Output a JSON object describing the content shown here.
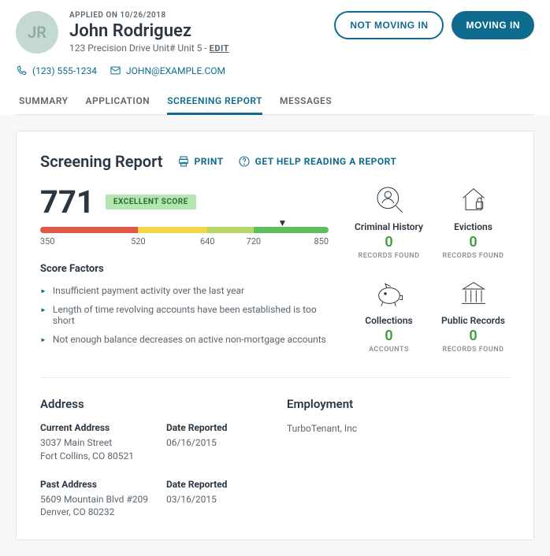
{
  "header": {
    "initials": "JR",
    "applied_label": "APPLIED ON 10/26/2018",
    "name": "John Rodriguez",
    "address": "123 Precision Drive Unit# Unit 5 - ",
    "edit": "EDIT",
    "phone": "(123) 555-1234",
    "email": "JOHN@EXAMPLE.COM",
    "btn_not_moving": "NOT MOVING IN",
    "btn_moving": "MOVING IN"
  },
  "tabs": {
    "summary": "SUMMARY",
    "application": "APPLICATION",
    "screening": "SCREENING REPORT",
    "messages": "MESSAGES"
  },
  "report": {
    "title": "Screening Report",
    "print": "PRINT",
    "help": "GET HELP READING A REPORT",
    "score": "771",
    "badge": "EXCELLENT SCORE",
    "ticks": {
      "t0": "350",
      "t1": "520",
      "t2": "640",
      "t3": "720",
      "t4": "850"
    },
    "factors_title": "Score Factors",
    "factors": {
      "f0": "Insufficient payment activity over the last year",
      "f1": "Length of time revolving accounts have been established is too short",
      "f2": "Not enough balance decreases on active non-mortgage accounts"
    }
  },
  "records": {
    "criminal": {
      "label": "Criminal History",
      "count": "0",
      "sub": "RECORDS FOUND"
    },
    "evictions": {
      "label": "Evictions",
      "count": "0",
      "sub": "RECORDS FOUND"
    },
    "collections": {
      "label": "Collections",
      "count": "0",
      "sub": "ACCOUNTS"
    },
    "public": {
      "label": "Public Records",
      "count": "0",
      "sub": "RECORDS FOUND"
    }
  },
  "bottom": {
    "address_title": "Address",
    "current_label": "Current Address",
    "current_line1": "3037 Main Street",
    "current_line2": "Fort Collins, CO 80521",
    "date_label": "Date Reported",
    "current_date": "06/16/2015",
    "past_label": "Past Address",
    "past_line1": "5609 Mountain Blvd #209",
    "past_line2": "Denver, CO 80232",
    "past_date": "03/16/2015",
    "employment_title": "Employment",
    "employer": "TurboTenant, Inc"
  }
}
